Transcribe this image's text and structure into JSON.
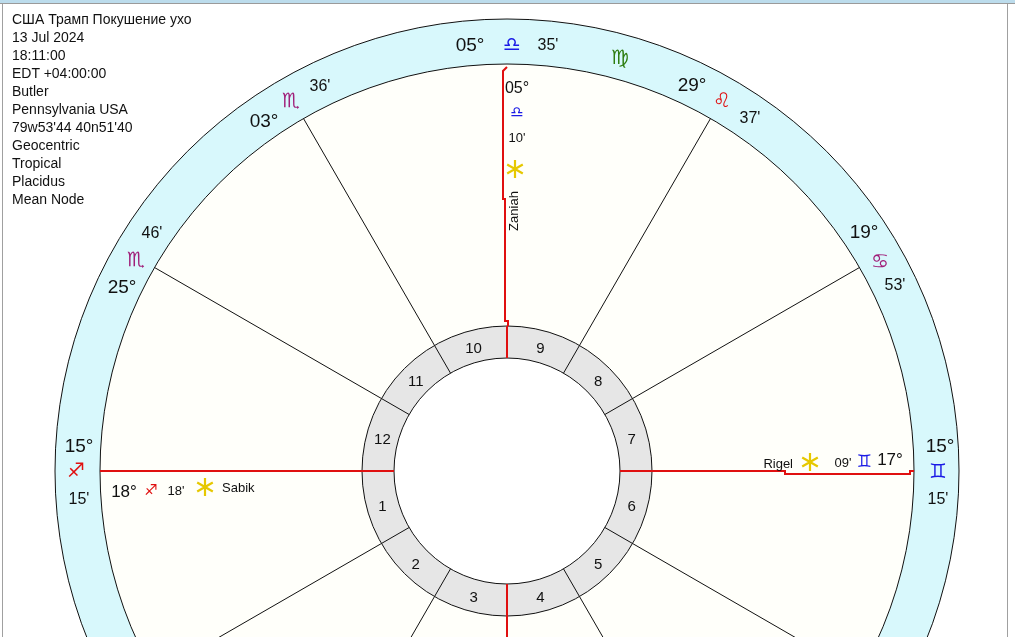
{
  "chart_info": [
    "США Трамп Покушение ухо",
    "13 Jul 2024",
    "18:11:00",
    "EDT +04:00:00",
    "Butler",
    "Pennsylvania USA",
    "79w53'44 40n51'40",
    "Geocentric",
    "Tropical",
    "Placidus",
    "Mean Node"
  ],
  "cusps": [
    {
      "degree": "05°",
      "sign": "♎",
      "minutes": "35'",
      "color": "#1a1ae6"
    },
    {
      "degree": "29°",
      "sign": "♌",
      "minutes": "37'",
      "color": "#e01010"
    },
    {
      "degree": "19°",
      "sign": "♋",
      "minutes": "53'",
      "color": "#a0207a"
    },
    {
      "degree": "15°",
      "sign": "♐",
      "minutes": "15'",
      "color": "#e01010"
    },
    {
      "degree": "15°",
      "sign": "♊",
      "minutes": "15'",
      "color": "#1a1ae6"
    },
    {
      "degree": "25°",
      "sign": "♏",
      "minutes": "46'",
      "color": "#a0207a"
    },
    {
      "degree": "03°",
      "sign": "♏",
      "minutes": "36'",
      "color": "#a0207a"
    }
  ],
  "intercepted_signs": [
    {
      "sign": "♍",
      "color": "#2e7d10"
    }
  ],
  "houses": [
    "1",
    "2",
    "3",
    "4",
    "5",
    "6",
    "7",
    "8",
    "9",
    "10",
    "11",
    "12"
  ],
  "fixed_stars": [
    {
      "name": "Zaniah",
      "degree": "05°",
      "sign": "♎",
      "minutes": "10'",
      "color": "#1a1ae6"
    },
    {
      "name": "Sabik",
      "degree": "18°",
      "sign": "♐",
      "minutes": "18'",
      "color": "#e01010"
    },
    {
      "name": "Rigel",
      "degree": "17°",
      "sign": "♊",
      "minutes": "09'",
      "color": "#1a1ae6"
    }
  ]
}
